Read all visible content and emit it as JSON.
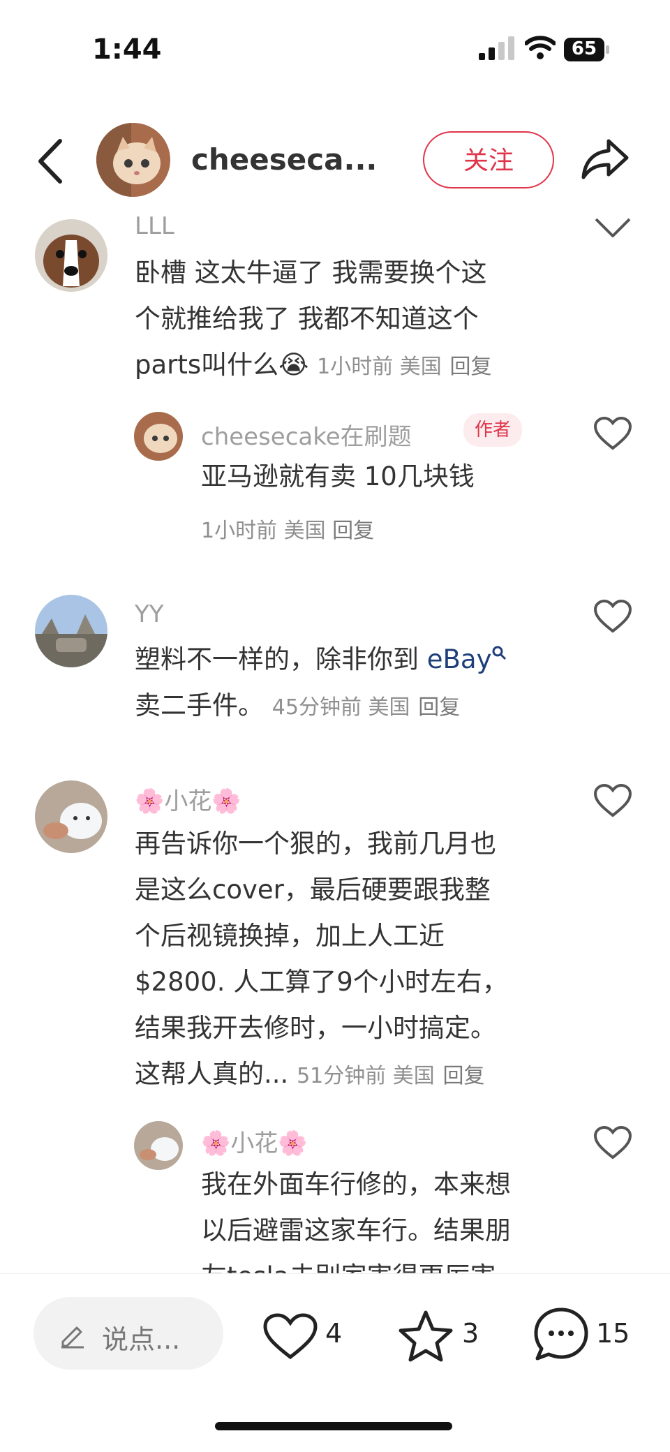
{
  "status_bar": {
    "time": "1:44",
    "battery": "65"
  },
  "header": {
    "username": "cheeseca...",
    "follow_label": "关注"
  },
  "comments": [
    {
      "name": "LLL",
      "text_lines": [
        "卧槽 这太牛逼了 我需要换个这",
        "个就推给我了 我都不知道这个"
      ],
      "last_line": "parts叫什么",
      "emoji": "😭",
      "meta": "1小时前 美国",
      "reply": "回复"
    },
    {
      "name": "cheesecake在刷题",
      "badge": "作者",
      "text": "亚马逊就有卖 10几块钱",
      "meta": "1小时前 美国",
      "reply": "回复"
    },
    {
      "name": "YY",
      "line1_prefix": "塑料不一样的，除非你到 ",
      "line1_link": "eBay",
      "line2": "卖二手件。",
      "meta": "45分钟前 美国",
      "reply": "回复"
    },
    {
      "name": "🌸小花🌸",
      "text_lines": [
        "再告诉你一个狠的，我前几月也",
        "是这么cover，最后硬要跟我整",
        "个后视镜换掉，加上人工近",
        "$2800. 人工算了9个小时左右，",
        "结果我开去修时，一小时搞定。"
      ],
      "last_line": "这帮人真的...",
      "meta": "51分钟前 美国",
      "reply": "回复"
    },
    {
      "name": "🌸小花🌸",
      "text_lines": [
        "我在外面车行修的，本来想",
        "以后避雷这家车行。结果朋",
        "友tesla去别家害得更厉害"
      ]
    }
  ],
  "bottom": {
    "input_placeholder": "说点...",
    "likes": "4",
    "favorites": "3",
    "comments": "15"
  }
}
